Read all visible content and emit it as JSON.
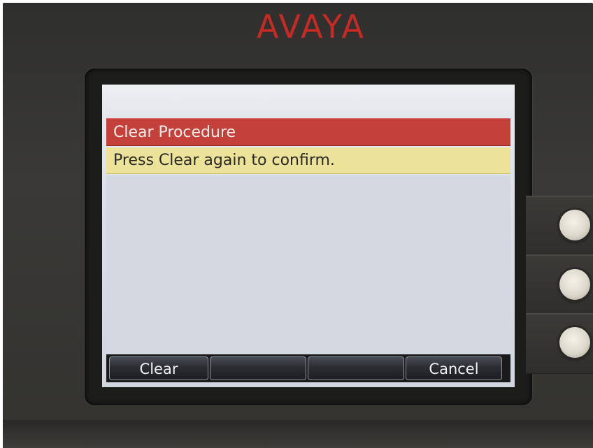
{
  "device": {
    "brand": "AVAYA"
  },
  "screen": {
    "title": "Clear Procedure",
    "prompt": "Press Clear again to confirm."
  },
  "softkeys": [
    {
      "label": "Clear"
    },
    {
      "label": ""
    },
    {
      "label": ""
    },
    {
      "label": "Cancel"
    }
  ],
  "colors": {
    "title_bar": "#c4403a",
    "prompt_bar": "#ece29a",
    "brand_red": "#c62a24"
  }
}
